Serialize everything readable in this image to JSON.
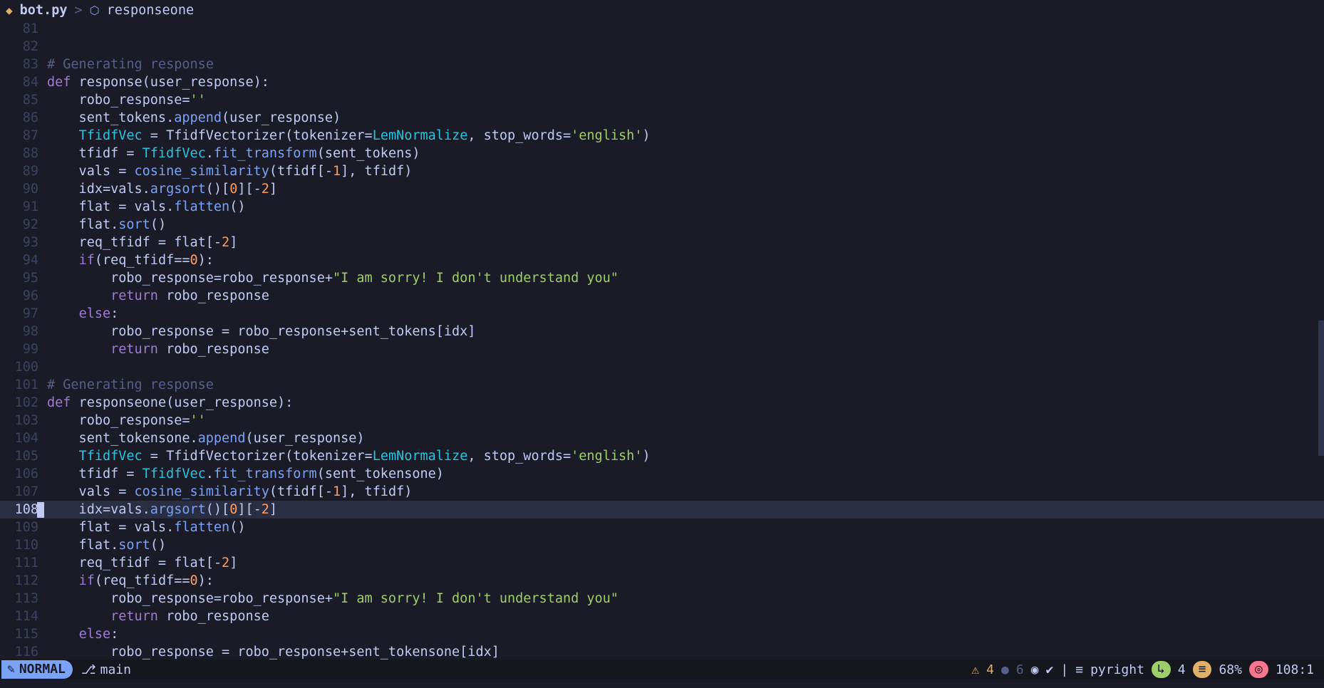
{
  "winbar": {
    "file_icon": "python-icon",
    "file": "bot.py",
    "separator": ">",
    "symbol_icon": "cube-icon",
    "symbol": "responseone"
  },
  "editor": {
    "current_line": 108,
    "lines": [
      {
        "n": "81",
        "code": ""
      },
      {
        "n": "82",
        "code": ""
      },
      {
        "n": "83",
        "code": "# Generating response"
      },
      {
        "n": "84",
        "code": "def response(user_response):"
      },
      {
        "n": "85",
        "code": "    robo_response=''"
      },
      {
        "n": "86",
        "code": "    sent_tokens.append(user_response)"
      },
      {
        "n": "87",
        "code": "    TfidfVec = TfidfVectorizer(tokenizer=LemNormalize, stop_words='english')"
      },
      {
        "n": "88",
        "code": "    tfidf = TfidfVec.fit_transform(sent_tokens)"
      },
      {
        "n": "89",
        "code": "    vals = cosine_similarity(tfidf[-1], tfidf)"
      },
      {
        "n": "90",
        "code": "    idx=vals.argsort()[0][-2]"
      },
      {
        "n": "91",
        "code": "    flat = vals.flatten()"
      },
      {
        "n": "92",
        "code": "    flat.sort()"
      },
      {
        "n": "93",
        "code": "    req_tfidf = flat[-2]"
      },
      {
        "n": "94",
        "code": "    if(req_tfidf==0):"
      },
      {
        "n": "95",
        "code": "        robo_response=robo_response+\"I am sorry! I don't understand you\""
      },
      {
        "n": "96",
        "code": "        return robo_response"
      },
      {
        "n": "97",
        "code": "    else:"
      },
      {
        "n": "98",
        "code": "        robo_response = robo_response+sent_tokens[idx]"
      },
      {
        "n": "99",
        "code": "        return robo_response"
      },
      {
        "n": "100",
        "code": ""
      },
      {
        "n": "101",
        "code": "# Generating response"
      },
      {
        "n": "102",
        "code": "def responseone(user_response):"
      },
      {
        "n": "103",
        "code": "    robo_response=''"
      },
      {
        "n": "104",
        "code": "    sent_tokensone.append(user_response)"
      },
      {
        "n": "105",
        "code": "    TfidfVec = TfidfVectorizer(tokenizer=LemNormalize, stop_words='english')"
      },
      {
        "n": "106",
        "code": "    tfidf = TfidfVec.fit_transform(sent_tokensone)"
      },
      {
        "n": "107",
        "code": "    vals = cosine_similarity(tfidf[-1], tfidf)"
      },
      {
        "n": "108",
        "code": "    idx=vals.argsort()[0][-2]"
      },
      {
        "n": "109",
        "code": "    flat = vals.flatten()"
      },
      {
        "n": "110",
        "code": "    flat.sort()"
      },
      {
        "n": "111",
        "code": "    req_tfidf = flat[-2]"
      },
      {
        "n": "112",
        "code": "    if(req_tfidf==0):"
      },
      {
        "n": "113",
        "code": "        robo_response=robo_response+\"I am sorry! I don't understand you\""
      },
      {
        "n": "114",
        "code": "        return robo_response"
      },
      {
        "n": "115",
        "code": "    else:"
      },
      {
        "n": "116",
        "code": "        robo_response = robo_response+sent_tokensone[idx]"
      }
    ]
  },
  "statusline": {
    "mode": "NORMAL",
    "branch": "main",
    "warnings": "4",
    "hints": "6",
    "lsp": "pyright",
    "indent": "4",
    "percent": "68%",
    "position": "108:1"
  },
  "colors": {
    "background": "#1a1b26",
    "mode_bg": "#7aa2f7",
    "current_line_bg": "#292e42"
  }
}
